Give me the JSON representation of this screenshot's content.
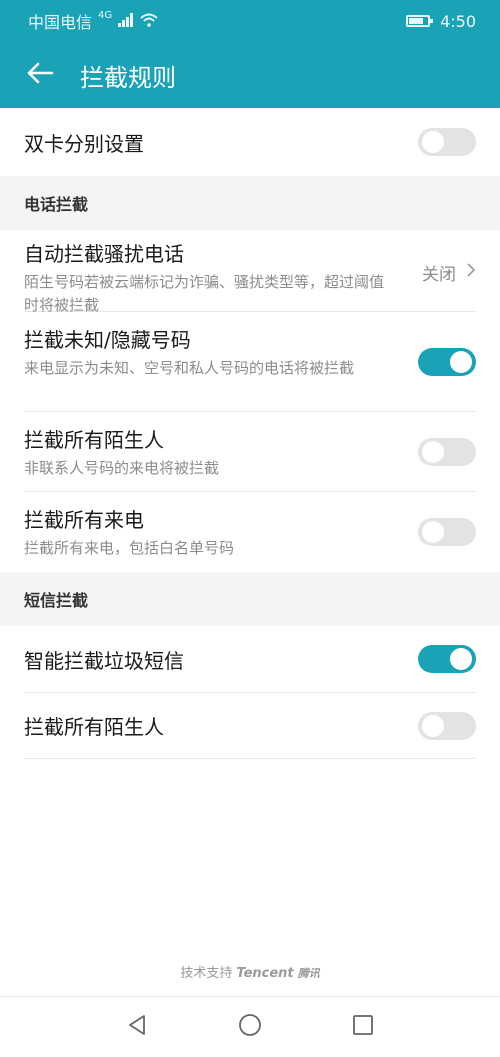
{
  "status": {
    "carrier": "中国电信",
    "network": "4G",
    "time": "4:50",
    "battery_level": 0.8
  },
  "header": {
    "title": "拦截规则",
    "back_icon": "back-arrow-icon"
  },
  "dual_sim": {
    "label": "双卡分别设置",
    "on": false
  },
  "call_section": {
    "title": "电话拦截",
    "items": [
      {
        "label": "自动拦截骚扰电话",
        "sub": "陌生号码若被云端标记为诈骗、骚扰类型等，超过阈值时将被拦截",
        "value": "关闭"
      },
      {
        "label": "拦截未知/隐藏号码",
        "sub": "来电显示为未知、空号和私人号码的电话将被拦截",
        "on": true
      },
      {
        "label": "拦截所有陌生人",
        "sub": "非联系人号码的来电将被拦截",
        "on": false
      },
      {
        "label": "拦截所有来电",
        "sub": "拦截所有来电，包括白名单号码",
        "on": false
      }
    ]
  },
  "sms_section": {
    "title": "短信拦截",
    "items": [
      {
        "label": "智能拦截垃圾短信",
        "on": true
      },
      {
        "label": "拦截所有陌生人",
        "on": false
      }
    ]
  },
  "footer": {
    "prefix": "技术支持",
    "brand": "Tencent",
    "brand_cn": "腾讯"
  },
  "colors": {
    "accent": "#1aa3b7",
    "toggle_off": "#e3e3e3",
    "text_secondary": "#8c8c8c"
  }
}
